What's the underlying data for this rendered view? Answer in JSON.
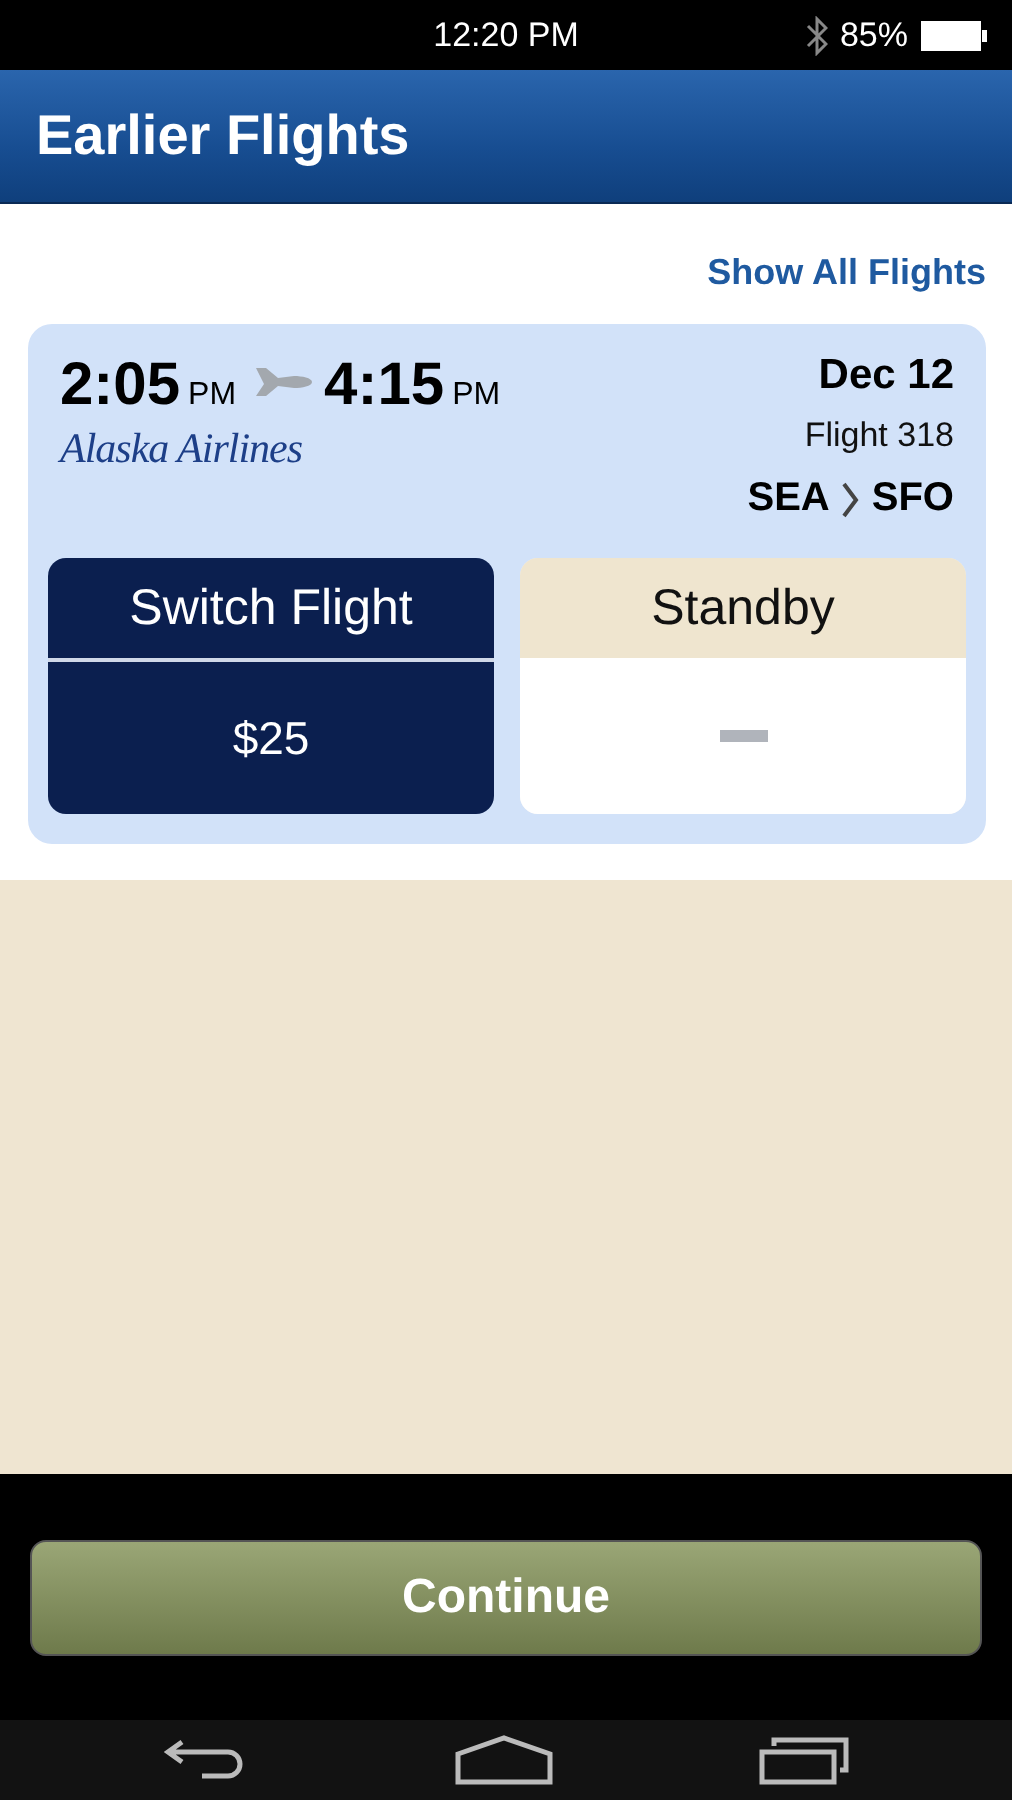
{
  "status_bar": {
    "time": "12:20 PM",
    "battery": "85%"
  },
  "header": {
    "title": "Earlier Flights"
  },
  "show_all_link": "Show All Flights",
  "flight": {
    "depart_time": "2:05",
    "depart_period": "PM",
    "arrive_time": "4:15",
    "arrive_period": "PM",
    "airline": "Alaska Airlines",
    "date": "Dec 12",
    "flight_number": "Flight 318",
    "origin": "SEA",
    "destination": "SFO"
  },
  "options": [
    {
      "label": "Switch Flight",
      "price": "$25",
      "selected": true
    },
    {
      "label": "Standby",
      "selected": false
    }
  ],
  "continue_button": "Continue"
}
